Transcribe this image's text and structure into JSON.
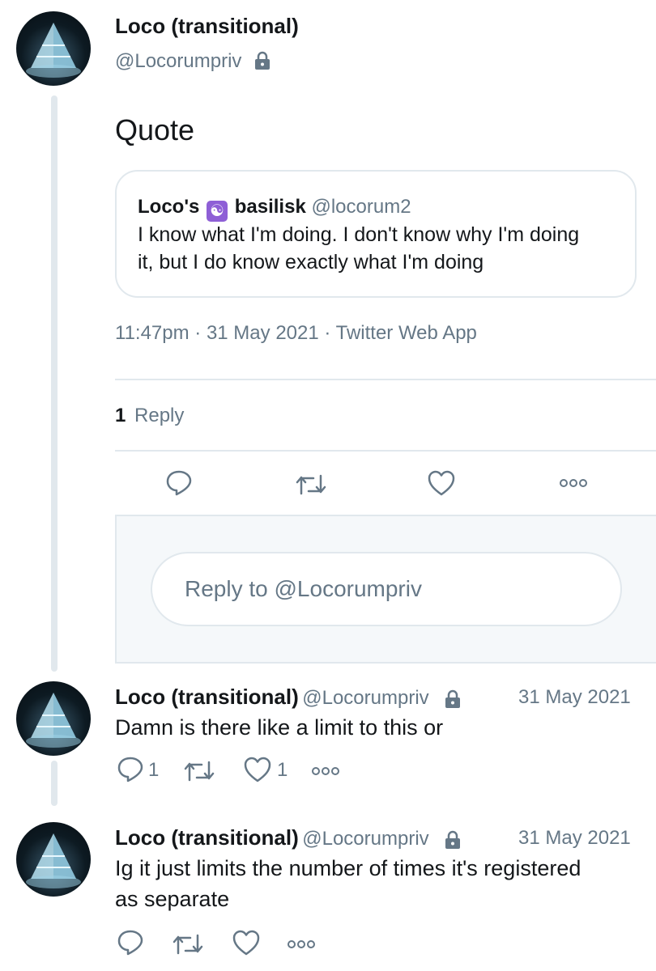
{
  "main_tweet": {
    "author_name": "Loco (transitional)",
    "author_handle": "@Locorumpriv",
    "text": "Quote",
    "quoted": {
      "name_prefix": "Loco's",
      "emoji": "☯",
      "name_suffix": "basilisk",
      "handle": "@locorum2",
      "line1": "I know what I'm doing. I don't know why I'm doing",
      "line2": "it, but I do know exactly what I'm doing"
    },
    "meta": "11:47pm · 31 May 2021 · Twitter Web App",
    "reply_count": "1",
    "reply_label": "Reply"
  },
  "reply_box": {
    "placeholder": "Reply to @Locorumpriv"
  },
  "replies": [
    {
      "author_name": "Loco (transitional)",
      "author_handle": "@Locorumpriv",
      "date": "31 May 2021",
      "line1": "Damn is there like a limit to this or",
      "line2": "",
      "reply_count": "1",
      "like_count": "1"
    },
    {
      "author_name": "Loco (transitional)",
      "author_handle": "@Locorumpriv",
      "date": "31 May 2021",
      "line1": "Ig it just limits the number of times it's registered",
      "line2": "as separate",
      "reply_count": "",
      "like_count": ""
    }
  ],
  "colors": {
    "text": "#14171a",
    "secondary": "#657786",
    "border": "#e1e8ed",
    "panel": "#f5f8fa",
    "emoji_bg": "#8e5fd6"
  },
  "icons": [
    "reply-icon",
    "retweet-icon",
    "like-icon",
    "more-icon",
    "lock-icon",
    "yin-yang-icon"
  ]
}
